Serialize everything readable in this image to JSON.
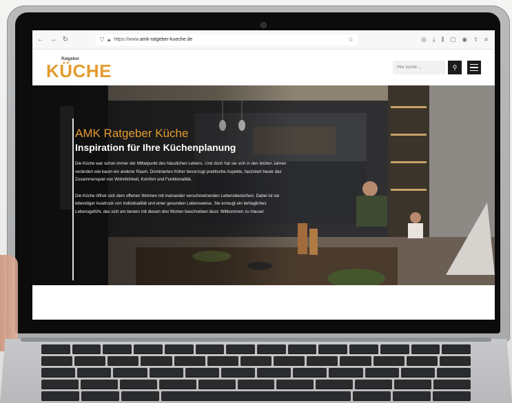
{
  "browser": {
    "url_prefix": "https://www.",
    "url_domain": "amk-ratgeber-kueche.de",
    "nav_icons": [
      "back-arrow-icon",
      "forward-arrow-icon",
      "reload-icon"
    ],
    "toolbar_icons": [
      "pocket-icon",
      "download-icon",
      "library-icon",
      "sidebar-icon",
      "account-icon",
      "extensions-icon",
      "menu-icon"
    ]
  },
  "site": {
    "logo_small": "Ratgeber",
    "logo_main": "KÜCHE",
    "search_placeholder": "Ihre Suche ...",
    "brand_color": "#e39b2f"
  },
  "hero": {
    "title": "AMK Ratgeber Küche",
    "subtitle": "Inspiration für Ihre Küchenplanung",
    "paragraph1": "Die Küche war schon immer der Mittelpunkt des häuslichen Lebens. Und doch hat sie sich in den letzten Jahren verändert wie kaum ein anderer Raum. Dominierten früher bevorzugt praktische Aspekte, fasziniert heute das Zusammenspiel von Wohnlichkeit, Komfort und Funktionalität.",
    "paragraph2": "Die Küche öffnet sich dem offenen Wohnen mit ineinander verschmelzenden Lebensbereichen. Dabei ist sie lebendiger Ausdruck von Individualität und einer gesunden Lebensweise. Sie erzeugt ein behagliches Lebensgefühl, das sich am besten mit diesen drei Worten beschreiben lässt: Willkommen zu Hause!"
  }
}
